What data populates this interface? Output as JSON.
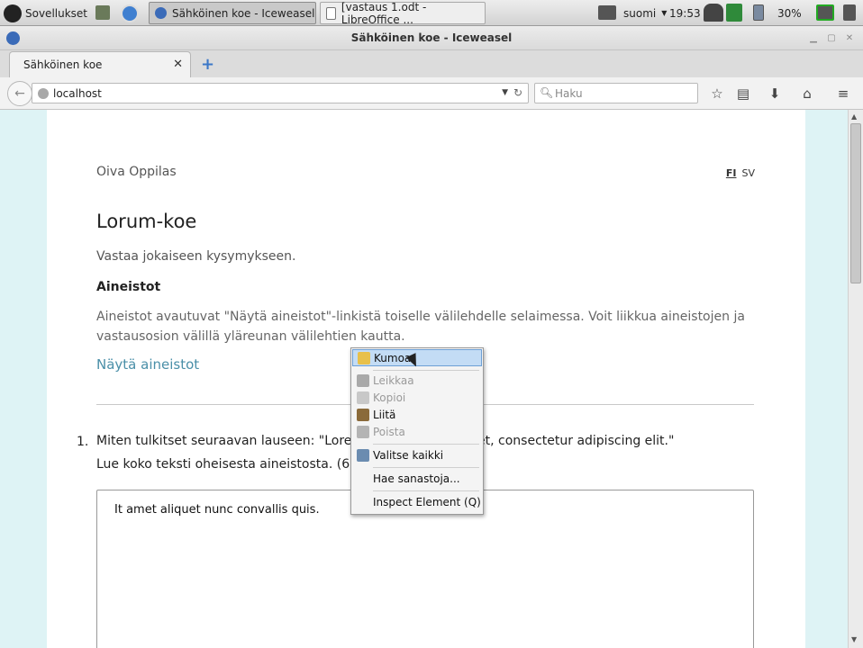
{
  "panel": {
    "apps_label": "Sovellukset",
    "tasks": [
      {
        "label": "Sähköinen koe - Iceweasel",
        "active": true
      },
      {
        "label": "[vastaus 1.odt - LibreOffice ...",
        "active": false
      }
    ],
    "keyboard_layout": "suomi",
    "clock": "19:53",
    "battery": "30%"
  },
  "window": {
    "title": "Sähköinen koe - Iceweasel"
  },
  "browser": {
    "tab_label": "Sähköinen koe",
    "url": "localhost",
    "search_placeholder": "Haku"
  },
  "page": {
    "user_name": "Oiva Oppilas",
    "lang_fi": "FI",
    "lang_sv": "SV",
    "exam_title": "Lorum-koe",
    "instructions": "Vastaa jokaiseen kysymykseen.",
    "materials_heading": "Aineistot",
    "materials_text": "Aineistot avautuvat \"Näytä aineistot\"-linkistä toiselle välilehdelle selaimessa. Voit liikkua aineistojen ja vastausosion välillä yläreunan välilehtien kautta.",
    "materials_link": "Näytä aineistot",
    "question_number": "1.",
    "question_line1_start": "Miten tulkitset seuraavan lauseen: \"Lore",
    "question_line1_end": "met, consectetur adipiscing elit.\"",
    "question_line2": "Lue koko teksti oheisesta aineistosta. (6",
    "answer_text": "It amet aliquet nunc convallis quis."
  },
  "context_menu": {
    "items": [
      {
        "label": "Kumoa",
        "highlighted": true,
        "disabled": false
      },
      {
        "label": "Leikkaa",
        "highlighted": false,
        "disabled": true
      },
      {
        "label": "Kopioi",
        "highlighted": false,
        "disabled": true
      },
      {
        "label": "Liitä",
        "highlighted": false,
        "disabled": false
      },
      {
        "label": "Poista",
        "highlighted": false,
        "disabled": true
      },
      {
        "label": "Valitse kaikki",
        "highlighted": false,
        "disabled": false
      },
      {
        "label": "Hae sanastoja...",
        "highlighted": false,
        "disabled": false
      },
      {
        "label": "Inspect Element (Q)",
        "highlighted": false,
        "disabled": false
      }
    ]
  },
  "colors": {
    "link": "#4a8fa8",
    "viewport_bg": "#def3f5",
    "menu_highlight": "#c3dcf5"
  }
}
